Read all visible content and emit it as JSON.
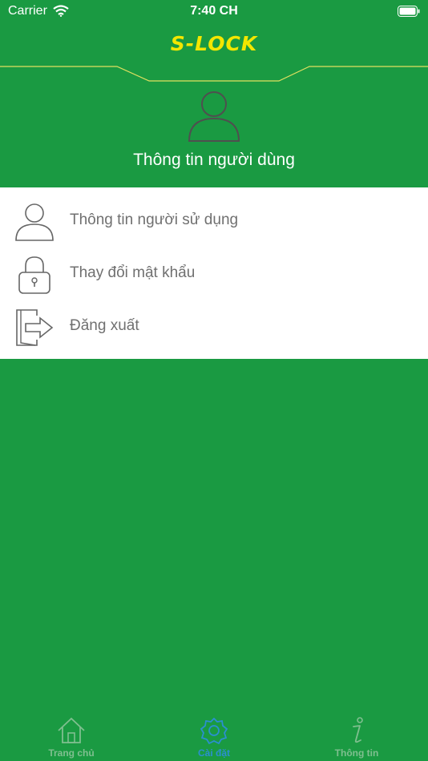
{
  "status_bar": {
    "carrier": "Carrier",
    "time": "7:40 CH"
  },
  "header": {
    "logo": "S-LOCK",
    "title": "Thông tin người dùng"
  },
  "menu": {
    "items": [
      {
        "label": "Thông tin người sử dụng",
        "icon": "person-icon"
      },
      {
        "label": "Thay đổi mật khẩu",
        "icon": "lock-icon"
      },
      {
        "label": "Đăng xuất",
        "icon": "logout-icon"
      }
    ]
  },
  "tab_bar": {
    "tabs": [
      {
        "label": "Trang chủ",
        "icon": "home-icon",
        "active": false
      },
      {
        "label": "Cài đặt",
        "icon": "settings-icon",
        "active": true
      },
      {
        "label": "Thông tin",
        "icon": "info-icon",
        "active": false
      }
    ]
  },
  "colors": {
    "background": "#1a9a42",
    "logo": "#f3e600",
    "active_tab": "#2b8fd0",
    "menu_text": "#707070"
  }
}
